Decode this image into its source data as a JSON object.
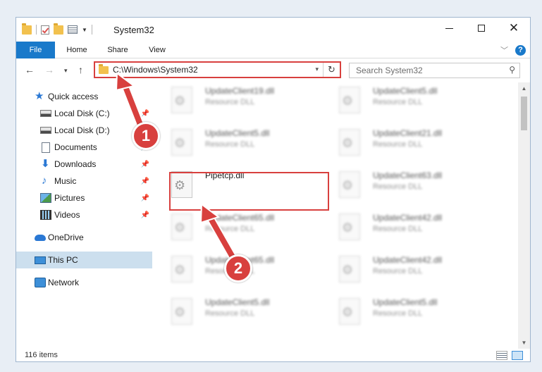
{
  "window": {
    "title": "System32",
    "controls": {
      "minimize": "",
      "maximize": "",
      "close": "✕"
    }
  },
  "ribbon": {
    "tabs": [
      "File",
      "Home",
      "Share",
      "View"
    ],
    "help": "?"
  },
  "nav": {
    "address_path": "C:\\Windows\\System32",
    "search_placeholder": "Search System32"
  },
  "sidebar": {
    "items": [
      {
        "label": "Quick access",
        "icon": "star-icon",
        "pinned": false
      },
      {
        "label": "Local Disk (C:)",
        "icon": "drive-icon",
        "pinned": true
      },
      {
        "label": "Local Disk (D:)",
        "icon": "drive-icon",
        "pinned": false
      },
      {
        "label": "Documents",
        "icon": "documents-icon",
        "pinned": true
      },
      {
        "label": "Downloads",
        "icon": "download-icon",
        "pinned": true
      },
      {
        "label": "Music",
        "icon": "music-icon",
        "pinned": true
      },
      {
        "label": "Pictures",
        "icon": "pictures-icon",
        "pinned": true
      },
      {
        "label": "Videos",
        "icon": "videos-icon",
        "pinned": true
      },
      {
        "label": "OneDrive",
        "icon": "cloud-icon",
        "pinned": false
      },
      {
        "label": "This PC",
        "icon": "computer-icon",
        "pinned": false,
        "selected": true
      },
      {
        "label": "Network",
        "icon": "network-icon",
        "pinned": false
      }
    ]
  },
  "files": [
    {
      "name": "UpdateClient19.dll",
      "type": "Resource DLL"
    },
    {
      "name": "UpdateClient5.dll",
      "type": "Resource DLL"
    },
    {
      "name": "UpdateClient5.dll",
      "type": "Resource DLL"
    },
    {
      "name": "UpdateClient21.dll",
      "type": "Resource DLL"
    },
    {
      "name": "Pipetcp.dll",
      "type": ""
    },
    {
      "name": "UpdateClient63.dll",
      "type": "Resource DLL"
    },
    {
      "name": "UpdateClient65.dll",
      "type": "Resource DLL"
    },
    {
      "name": "UpdateClient42.dll",
      "type": "Resource DLL"
    },
    {
      "name": "UpdateClient65.dll",
      "type": "Resource DLL"
    },
    {
      "name": "UpdateClient42.dll",
      "type": "Resource DLL"
    },
    {
      "name": "UpdateClient5.dll",
      "type": "Resource DLL"
    },
    {
      "name": "UpdateClient5.dll",
      "type": "Resource DLL"
    }
  ],
  "status": {
    "item_count": "116 items"
  },
  "annotations": {
    "step1": "1",
    "step2": "2",
    "color": "#d8403e"
  },
  "colors": {
    "accent": "#1979ca",
    "selection": "#ccdfee",
    "highlight": "#d8403e"
  }
}
